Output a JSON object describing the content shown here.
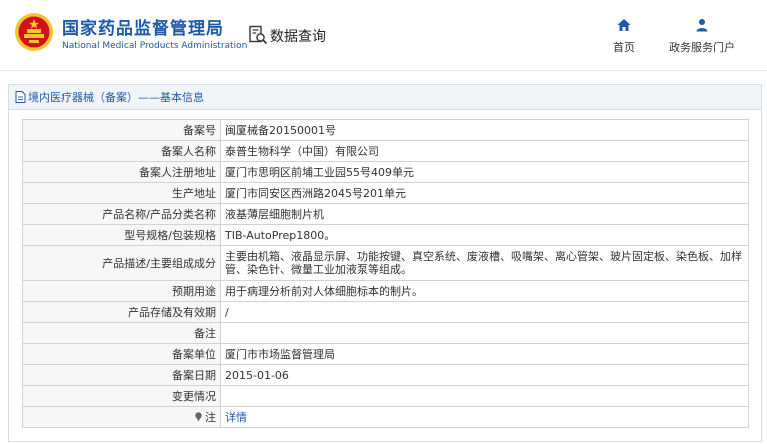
{
  "header": {
    "brand_cn": "国家药品监督管理局",
    "brand_en": "National Medical Products Administration",
    "query_label": "数据查询",
    "nav": {
      "home": "首页",
      "services": "政务服务门户"
    }
  },
  "panel": {
    "title": "境内医疗器械（备案）——基本信息"
  },
  "rows": [
    {
      "label": "备案号",
      "value": "闽厦械备20150001号"
    },
    {
      "label": "备案人名称",
      "value": "泰普生物科学（中国）有限公司"
    },
    {
      "label": "备案人注册地址",
      "value": "厦门市思明区前埔工业园55号409单元"
    },
    {
      "label": "生产地址",
      "value": "厦门市同安区西洲路2045号201单元"
    },
    {
      "label": "产品名称/产品分类名称",
      "value": "液基薄层细胞制片机"
    },
    {
      "label": "型号规格/包装规格",
      "value": "TIB-AutoPrep1800。"
    },
    {
      "label": "产品描述/主要组成成分",
      "value": "主要由机箱、液晶显示屏、功能按键、真空系统、废液槽、吸嘴架、离心管架、玻片固定板、染色板、加样管、染色针、微量工业加液泵等组成。"
    },
    {
      "label": "预期用途",
      "value": "用于病理分析前对人体细胞标本的制片。"
    },
    {
      "label": "产品存储及有效期",
      "value": "/"
    },
    {
      "label": "备注",
      "value": ""
    },
    {
      "label": "备案单位",
      "value": "厦门市市场监督管理局"
    },
    {
      "label": "备案日期",
      "value": "2015-01-06"
    },
    {
      "label": "变更情况",
      "value": ""
    }
  ],
  "note_row": {
    "label": "注",
    "link": "详情"
  },
  "colors": {
    "brand_blue": "#1e5aa8",
    "emblem_red": "#d0121b",
    "emblem_gold": "#f4c430"
  }
}
